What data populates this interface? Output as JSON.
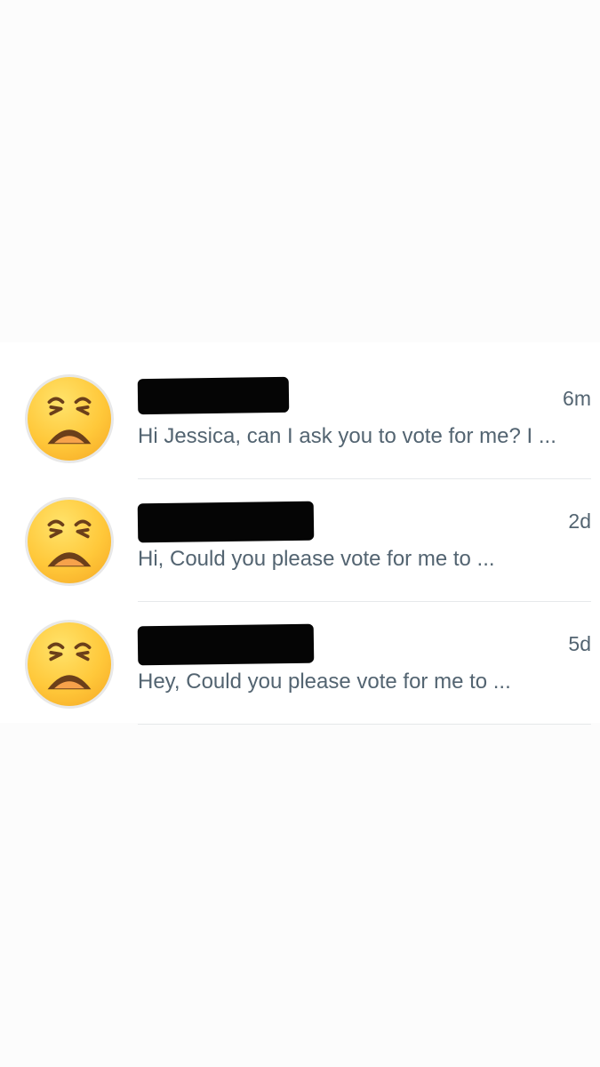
{
  "conversations": [
    {
      "time": "6m",
      "preview": "Hi Jessica, can I ask you to vote for me? I ...",
      "avatar_icon": "weary-face-emoji-icon"
    },
    {
      "time": "2d",
      "preview": "Hi, Could you please vote for me to ...",
      "avatar_icon": "weary-face-emoji-icon"
    },
    {
      "time": "5d",
      "preview": "Hey, Could you please vote for me to ...",
      "avatar_icon": "weary-face-emoji-icon"
    }
  ],
  "colors": {
    "secondary_text": "#536471",
    "divider": "#e6e9eb",
    "redaction": "#050505"
  }
}
